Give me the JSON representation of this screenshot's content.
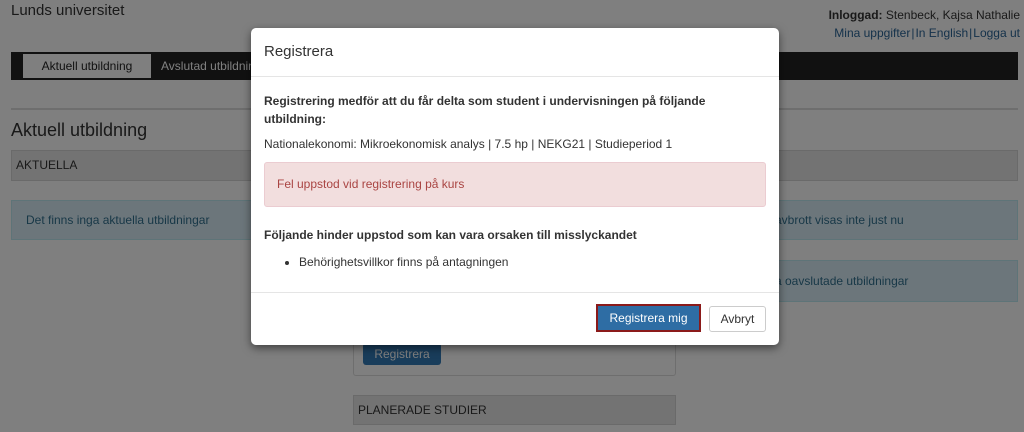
{
  "header": {
    "university": "Lunds universitet",
    "logged_in_label": "Inloggad:",
    "user_name": "Stenbeck, Kajsa Nathalie",
    "links": [
      "Mina uppgifter",
      "In English",
      "Logga ut"
    ]
  },
  "nav": {
    "tabs": [
      "Aktuell utbildning",
      "Avslutad utbildning"
    ]
  },
  "page": {
    "title": "Aktuell utbildning",
    "sections": {
      "current_heading": "AKTUELLA",
      "current_empty": "Det finns inga aktuella utbildningar",
      "breaks_text": "avbrott visas inte just nu",
      "unfinished_text": "a oavslutade utbildningar",
      "register_button": "Registrera",
      "planned_heading": "PLANERADE STUDIER"
    }
  },
  "modal": {
    "title": "Registrera",
    "intro": "Registrering medför att du får delta som student i undervisningen på följande utbildning:",
    "course": "Nationalekonomi: Mikroekonomisk analys | 7.5 hp | NEKG21 | Studieperiod 1",
    "error": "Fel uppstod vid registrering på kurs",
    "hinder_title": "Följande hinder uppstod som kan vara orsaken till misslyckandet",
    "hinders": [
      "Behörighetsvillkor finns på antagningen"
    ],
    "confirm_button": "Registrera mig",
    "cancel_button": "Avbryt"
  },
  "colors": {
    "navbar": "#222222",
    "primary": "#337ab7",
    "alert_danger_bg": "#f2dede",
    "alert_danger_text": "#a94442",
    "info_bg": "#d9edf7"
  }
}
